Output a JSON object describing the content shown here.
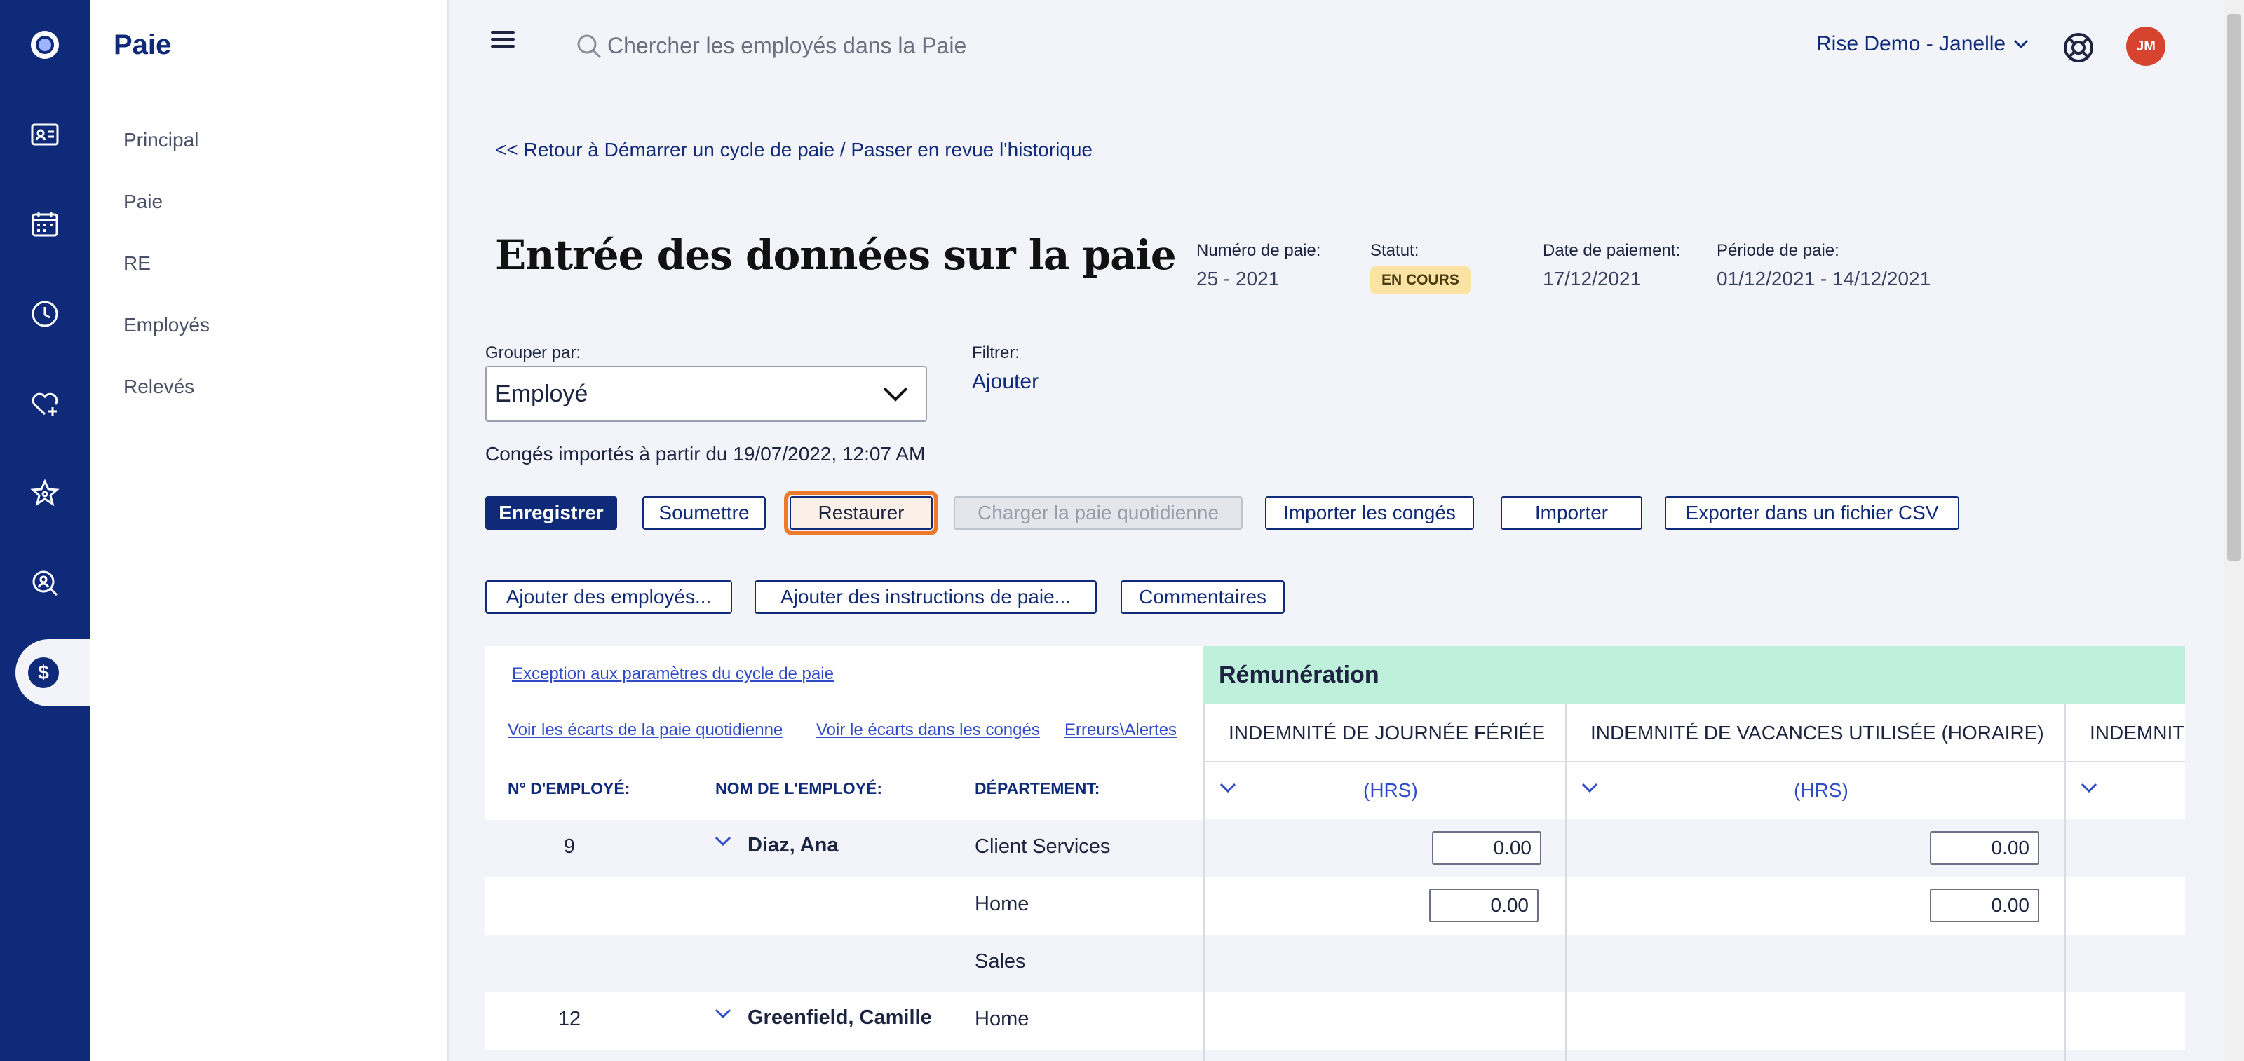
{
  "sidebar": {
    "title": "Paie",
    "items": [
      {
        "label": "Principal"
      },
      {
        "label": "Paie"
      },
      {
        "label": "RE"
      },
      {
        "label": "Employés"
      },
      {
        "label": "Relevés"
      }
    ]
  },
  "rail": {
    "icons": [
      "logo-icon",
      "employee-card-icon",
      "calendar-icon",
      "clock-icon",
      "heart-plus-icon",
      "star-icon",
      "search-person-icon",
      "dollar-icon"
    ],
    "active": "dollar-icon"
  },
  "topbar": {
    "search_placeholder": "Chercher les employés dans la Paie",
    "org": "Rise Demo - Janelle",
    "avatar_initials": "JM"
  },
  "header": {
    "back_link": "<< Retour à Démarrer un cycle de paie / Passer en revue l'historique",
    "title": "Entrée des données sur la paie",
    "pay_number_label": "Numéro de paie:",
    "pay_number": "25 - 2021",
    "status_label": "Statut:",
    "status": "EN COURS",
    "payment_date_label": "Date de paiement:",
    "payment_date": "17/12/2021",
    "pay_period_label": "Période de paie:",
    "pay_period": "01/12/2021 - 14/12/2021"
  },
  "controls": {
    "group_by_label": "Grouper par:",
    "group_by_value": "Employé",
    "filter_label": "Filtrer:",
    "filter_add": "Ajouter",
    "leave_info": "Congés importés à partir du 19/07/2022, 12:07 AM"
  },
  "actions": {
    "save": "Enregistrer",
    "submit": "Soumettre",
    "restore": "Restaurer",
    "load_daily": "Charger la paie quotidienne",
    "import_leave": "Importer les congés",
    "import": "Importer",
    "export_csv": "Exporter dans un fichier CSV",
    "add_employees": "Ajouter des employés...",
    "add_pay_instructions": "Ajouter des instructions de paie...",
    "comments": "Commentaires"
  },
  "table": {
    "exception_link": "Exception aux paramètres du cycle de paie",
    "links": [
      "Voir les écarts de la paie quotidienne",
      "Voir le écarts dans les congés",
      "Erreurs\\Alertes"
    ],
    "col_emp_num": "N° D'EMPLOYÉ:",
    "col_emp_name": "NOM DE L'EMPLOYÉ:",
    "col_department": "DÉPARTEMENT:",
    "remuneration": "Rémunération",
    "earning_cols": [
      {
        "title": "INDEMNITÉ DE JOURNÉE FÉRIÉE",
        "unit": "(HRS)"
      },
      {
        "title": "INDEMNITÉ DE VACANCES UTILISÉE (HORAIRE)",
        "unit": "(HRS)"
      },
      {
        "title": "INDEMNIT",
        "unit": ""
      }
    ],
    "rows": [
      {
        "emp_num": "9",
        "name": "Diaz, Ana",
        "department": "Client Services",
        "v1": "0.00",
        "v2": "0.00"
      },
      {
        "emp_num": "",
        "name": "",
        "department": "Home",
        "v1": "0.00",
        "v2": "0.00"
      },
      {
        "emp_num": "",
        "name": "",
        "department": "Sales",
        "v1": "",
        "v2": ""
      },
      {
        "emp_num": "12",
        "name": "Greenfield, Camille",
        "department": "Home",
        "v1": "",
        "v2": ""
      }
    ]
  }
}
